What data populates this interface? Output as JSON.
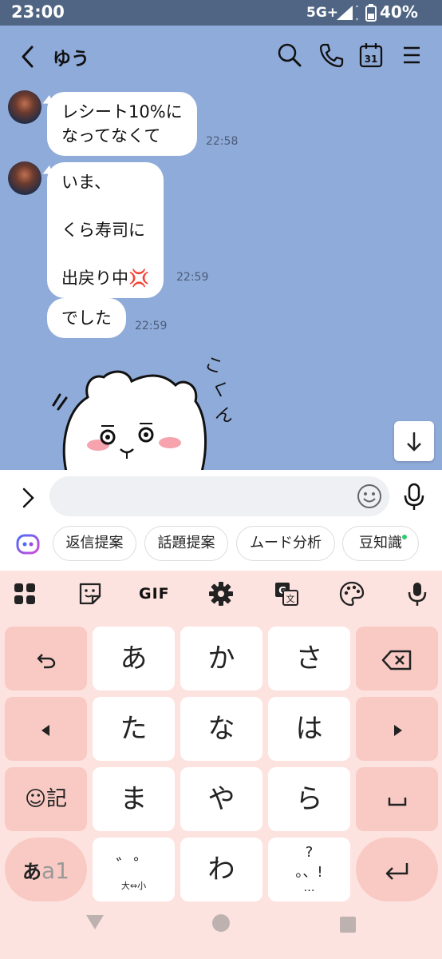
{
  "status_bar": {
    "time": "23:00",
    "network": "5G+",
    "battery": "40%"
  },
  "header": {
    "title": "ゆう"
  },
  "messages": [
    {
      "text": "レシート10%に\nなってなくて",
      "time": "22:58"
    },
    {
      "text": "いま、\n\nくら寿司に\n\n出戻り中💢",
      "time": "22:59"
    },
    {
      "text": "でした",
      "time": "22:59"
    }
  ],
  "input": {
    "placeholder": ""
  },
  "suggestions": [
    "返信提案",
    "話題提案",
    "ムード分析",
    "豆知識"
  ],
  "keyboard": {
    "toolbar": {
      "gif_label": "GIF"
    },
    "row1": [
      "あ",
      "か",
      "さ"
    ],
    "row2": [
      "た",
      "な",
      "は"
    ],
    "row3": [
      "ま",
      "や",
      "ら"
    ],
    "row4_main": "わ",
    "emoji_key": "☺記",
    "mode_key_a": "あ",
    "mode_key_b": "a1",
    "dakuten_key": "゛゜",
    "dakuten_sub": "大⇔小",
    "punct_top": "?",
    "punct_mid": "。、!",
    "punct_bottom": "…"
  },
  "colors": {
    "chat_bg": "#8fabd9",
    "keyboard_bg": "#fde3df",
    "fn_key": "#f9cac4",
    "status_bar": "#4f6583"
  }
}
